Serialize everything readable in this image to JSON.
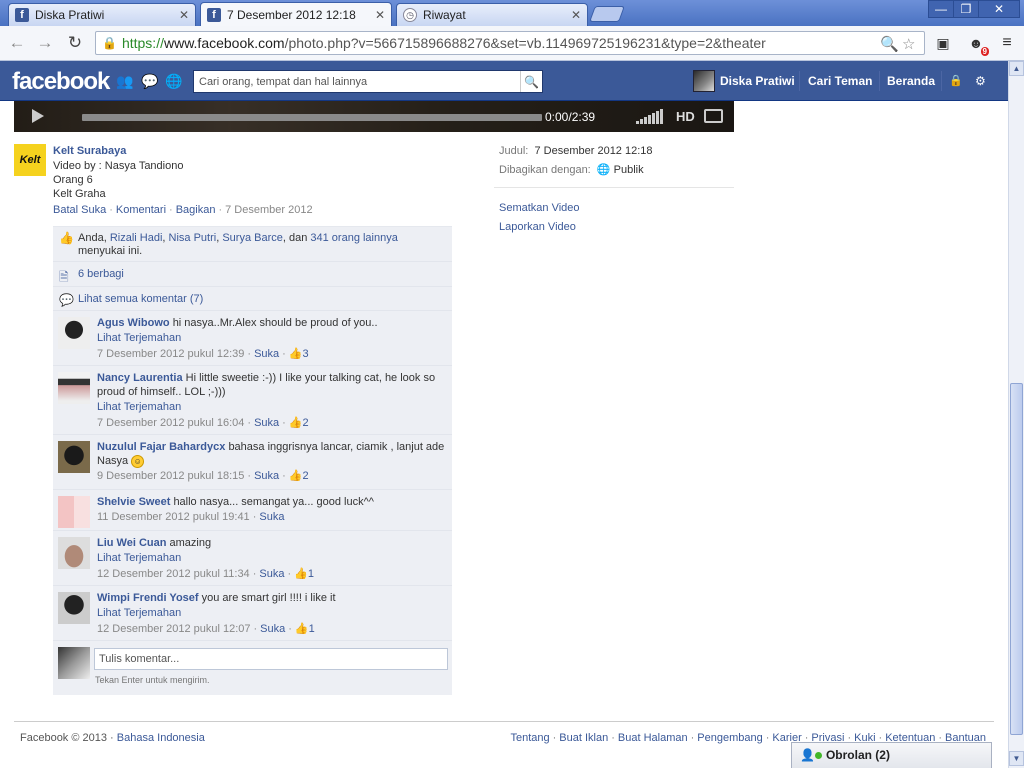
{
  "browser": {
    "tabs": [
      {
        "title": "Diska Pratiwi",
        "icon": "facebook-icon"
      },
      {
        "title": "7 Desember 2012 12:18",
        "icon": "facebook-icon"
      },
      {
        "title": "Riwayat",
        "icon": "history-icon"
      }
    ],
    "url_scheme": "https://",
    "url_host": "www.facebook.com",
    "url_path": "/photo.php?v=566715896688276&set=vb.114969725196231&type=2&theater",
    "extension_badge": "9"
  },
  "fb": {
    "logo": "facebook",
    "search_placeholder": "Cari orang, tempat dan hal lainnya",
    "user_name": "Diska Pratiwi",
    "nav_find_friends": "Cari Teman",
    "nav_home": "Beranda"
  },
  "player": {
    "time": "0:00/2:39",
    "hd_label": "HD"
  },
  "post": {
    "owner": "Kelt Surabaya",
    "owner_logo_text": "Kelt",
    "caption_lines": [
      "Video by : Nasya Tandiono",
      "Orang 6",
      "Kelt Graha"
    ],
    "actions": {
      "unlike": "Batal Suka",
      "comment": "Komentari",
      "share": "Bagikan",
      "date": "7 Desember 2012"
    },
    "likes": {
      "you": "Anda,",
      "names": [
        "Rizali Hadi",
        "Nisa Putri",
        "Surya Barce"
      ],
      "and": ", dan",
      "others": "341 orang lainnya",
      "tail": "menyukai ini."
    },
    "shares": "6 berbagi",
    "view_all_comments": "Lihat semua komentar (7)",
    "comments": [
      {
        "author": "Agus Wibowo",
        "text": "hi nasya..Mr.Alex should be proud of you..",
        "translate": "Lihat Terjemahan",
        "time": "7 Desember 2012 pukul 12:39",
        "like": "Suka",
        "likes": "3"
      },
      {
        "author": "Nancy Laurentia",
        "text": "Hi little sweetie :-)) I like your talking cat, he look so proud of himself.. LOL ;-)))",
        "translate": "Lihat Terjemahan",
        "time": "7 Desember 2012 pukul 16:04",
        "like": "Suka",
        "likes": "2"
      },
      {
        "author": "Nuzulul Fajar Bahardycx",
        "text": "bahasa inggrisnya lancar, ciamik , lanjut ade Nasya",
        "translate": "",
        "time": "9 Desember 2012 pukul 18:15",
        "like": "Suka",
        "likes": "2"
      },
      {
        "author": "Shelvie Sweet",
        "text": "hallo nasya... semangat ya... good luck^^",
        "translate": "",
        "time": "11 Desember 2012 pukul 19:41",
        "like": "Suka",
        "likes": ""
      },
      {
        "author": "Liu Wei Cuan",
        "text": "amazing",
        "translate": "Lihat Terjemahan",
        "time": "12 Desember 2012 pukul 11:34",
        "like": "Suka",
        "likes": "1"
      },
      {
        "author": "Wimpi Frendi Yosef",
        "text": "you are smart girl !!!! i like it",
        "translate": "Lihat Terjemahan",
        "time": "12 Desember 2012 pukul 12:07",
        "like": "Suka",
        "likes": "1"
      }
    ],
    "compose_placeholder": "Tulis komentar...",
    "compose_hint": "Tekan Enter untuk mengirim."
  },
  "info": {
    "title_label": "Judul:",
    "title_value": "7 Desember 2012 12:18",
    "shared_label": "Dibagikan dengan:",
    "shared_value": "Publik",
    "embed": "Sematkan Video",
    "report": "Laporkan Video"
  },
  "footer": {
    "copyright": "Facebook © 2013 ·",
    "language": "Bahasa Indonesia",
    "links": [
      "Tentang",
      "Buat Iklan",
      "Buat Halaman",
      "Pengembang",
      "Karier",
      "Privasi",
      "Kuki",
      "Ketentuan",
      "Bantuan"
    ]
  },
  "chat": {
    "label": "Obrolan (2)"
  },
  "colors": {
    "fb_blue": "#3b5998",
    "ufi_bg": "#edeff4"
  }
}
